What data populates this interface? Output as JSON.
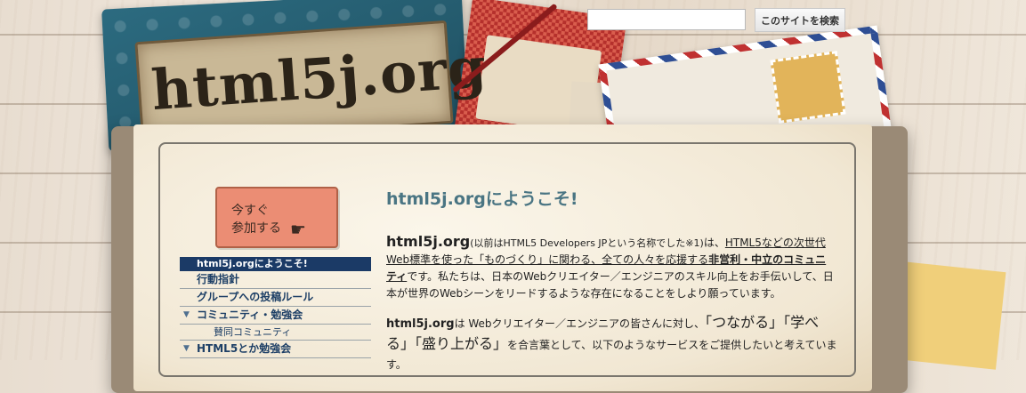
{
  "site": {
    "logo_text": "html5j.org"
  },
  "search": {
    "placeholder": "",
    "button_label": "このサイトを検索"
  },
  "join_button": {
    "line1": "今すぐ",
    "line2": "参加する"
  },
  "nav": {
    "items": [
      {
        "label": "html5j.orgにようこそ!",
        "active": true
      },
      {
        "label": "行動指針"
      },
      {
        "label": "グループへの投稿ルール"
      },
      {
        "label": "コミュニティ・勉強会",
        "expandable": true
      },
      {
        "label": "賛同コミュニティ",
        "sub": true
      },
      {
        "label": "HTML5とか勉強会",
        "expandable": true
      }
    ]
  },
  "main": {
    "heading": "html5j.orgにようこそ!",
    "para1": {
      "brand": "html5j.org",
      "paren": "(以前はHTML5 Developers JPという名称でした※1)",
      "after_paren": "は、",
      "underlined": "HTML5などの次世代Web標準を使った「ものづくり」に関わる、全ての人々を応援する",
      "bold_underlined": "非営利・中立のコミュニティ",
      "rest": "です。私たちは、日本のWebクリエイター／エンジニアのスキル向上をお手伝いして、日本が世界のWebシーンをリードするような存在になることをしより願っています。"
    },
    "para2": {
      "brand": "html5j.org",
      "text1": "は Webクリエイター／エンジニアの皆さんに対し、",
      "q1": "「つながる」",
      "q2": "「学べる」",
      "q3": "「盛り上がる」",
      "text2": "を合言葉として、以下のようなサービスをご提供したいと考えています。"
    }
  }
}
